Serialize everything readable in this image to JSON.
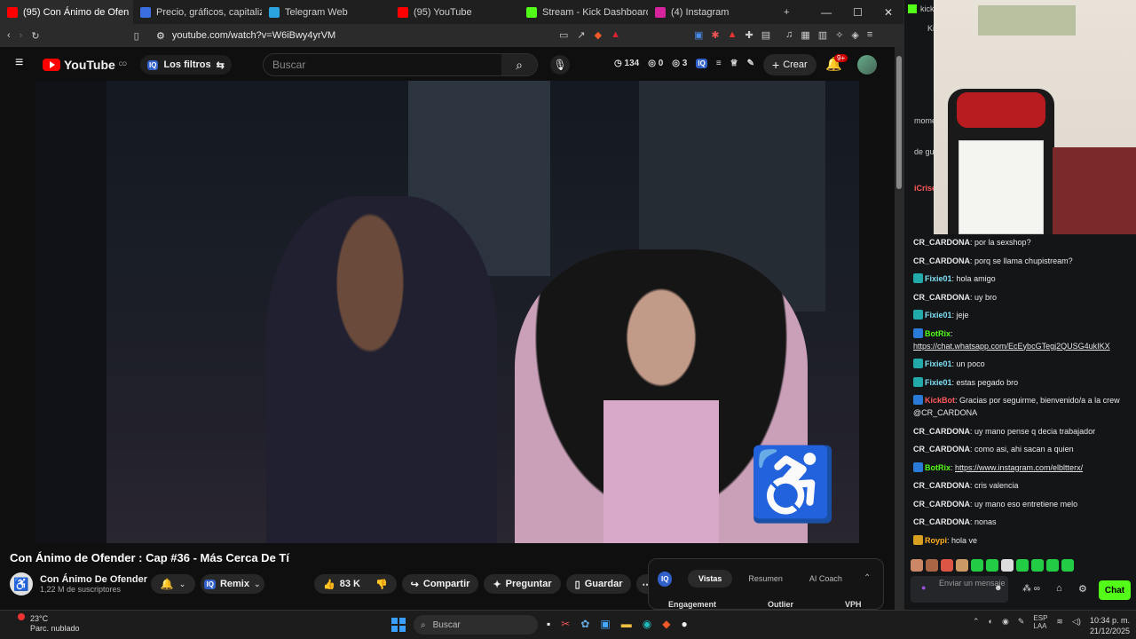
{
  "tabs": [
    {
      "label": "(95) Con Ánimo de Ofen",
      "color": "#ff0000",
      "active": true
    },
    {
      "label": "Precio, gráficos, capitalización d",
      "color": "#3b6ee0"
    },
    {
      "label": "Telegram Web",
      "color": "#2aa3e0"
    },
    {
      "label": "(95) YouTube",
      "color": "#ff0000"
    },
    {
      "label": "Stream - Kick Dashboard",
      "color": "#53fc18"
    },
    {
      "label": "(4) Instagram",
      "color": "#d6249f"
    }
  ],
  "new_tab": "+",
  "address": {
    "url": "youtube.com/watch?v=W6iBwy4yrVM"
  },
  "youtube": {
    "logo_text": "YouTube",
    "country": "CO",
    "filters_label": "Los filtros",
    "iq_badge": "IQ",
    "search_placeholder": "Buscar",
    "stats": [
      "134",
      "0",
      "3"
    ],
    "create_label": "Crear",
    "notif_count": "9+",
    "video_title": "Con Ánimo de Ofender : Cap #36 - Más Cerca De Tí",
    "channel_name": "Con Ánimo De Ofender",
    "channel_subs": "1,22 M de suscriptores",
    "remix_label": "Remix",
    "like_count": "83 K",
    "share_label": "Compartir",
    "ask_label": "Preguntar",
    "save_label": "Guardar",
    "iq_tabs": [
      "Vistas",
      "Resumen",
      "AI Coach"
    ],
    "iq_cols": [
      "Engagement",
      "Outlier",
      "VPH"
    ]
  },
  "chat": {
    "top_fragments": [
      "kick.c",
      "Kic",
      "mome",
      "de gu",
      "iCrise"
    ],
    "messages": [
      {
        "user": "CR_CARDONA",
        "cls": "u-cr",
        "text": "por la sexshop?"
      },
      {
        "user": "CR_CARDONA",
        "cls": "u-cr",
        "text": "porq se llama chupistream?"
      },
      {
        "user": "Fixie01",
        "cls": "u-fix",
        "text": "hola amigo",
        "badge": "#2aa"
      },
      {
        "user": "CR_CARDONA",
        "cls": "u-cr",
        "text": "uy bro"
      },
      {
        "user": "Fixie01",
        "cls": "u-fix",
        "text": "jeje",
        "badge": "#2aa"
      },
      {
        "user": "BotRix",
        "cls": "u-bot",
        "text": "",
        "link": "https://chat.whatsapp.com/EcEybcGTegj2QUSG4ukIKX",
        "badge": "#2a7ad8"
      },
      {
        "user": "Fixie01",
        "cls": "u-fix",
        "text": "un poco",
        "badge": "#2aa"
      },
      {
        "user": "Fixie01",
        "cls": "u-fix",
        "text": "estas pegado bro",
        "badge": "#2aa"
      },
      {
        "user": "KickBot",
        "cls": "u-kick",
        "text": "Gracias por seguirme, bienvenido/a a la crew @CR_CARDONA",
        "badge": "#2a7ad8"
      },
      {
        "user": "CR_CARDONA",
        "cls": "u-cr",
        "text": "uy mano pense q decia trabajador"
      },
      {
        "user": "CR_CARDONA",
        "cls": "u-cr",
        "text": "como asi, ahi sacan a quien"
      },
      {
        "user": "BotRix",
        "cls": "u-bot",
        "text": "",
        "link": "https://www.instagram.com/elbltterx/",
        "badge": "#2a7ad8"
      },
      {
        "user": "CR_CARDONA",
        "cls": "u-cr",
        "text": "cris valencia"
      },
      {
        "user": "CR_CARDONA",
        "cls": "u-cr",
        "text": "uy mano eso entretiene melo"
      },
      {
        "user": "CR_CARDONA",
        "cls": "u-cr",
        "text": "nonas"
      },
      {
        "user": "Roypi",
        "cls": "u-roy",
        "text": "hola ve",
        "badge": "#d8a020"
      }
    ],
    "input_placeholder": "Enviar un mensaje",
    "send_label": "Chat"
  },
  "taskbar": {
    "temperature": "23°C",
    "weather": "Parc. nublado",
    "search_label": "Buscar",
    "lang": "ESP",
    "lang2": "LAA",
    "time": "10:34 p. m.",
    "date": "21/12/2025"
  },
  "colors": {
    "accent_red": "#ff0000",
    "kick_green": "#53fc18"
  }
}
